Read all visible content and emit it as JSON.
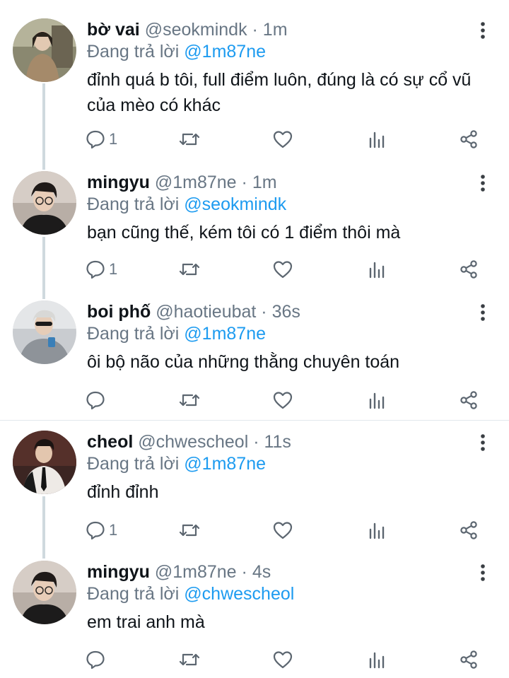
{
  "colors": {
    "text": "#0f1419",
    "secondary": "#687684",
    "link": "#1d9bf0",
    "thread": "#cfd9de"
  },
  "replies": [
    {
      "name": "bờ vai",
      "handle": "@seokmindk",
      "time": "1m",
      "replying_label": "Đang trả lời",
      "replying_to": "@1m87ne",
      "text": "đỉnh quá b tôi, full điểm luôn, đúng là có sự cổ vũ của mèo có khác",
      "reply_count": "1",
      "avatar": "avatar-photo-boy-with-long-hair"
    },
    {
      "name": "mingyu",
      "handle": "@1m87ne",
      "time": "1m",
      "replying_label": "Đang trả lời",
      "replying_to": "@seokmindk",
      "text": "bạn cũng thế, kém tôi có 1 điểm thôi mà",
      "reply_count": "1",
      "avatar": "avatar-photo-boy-with-glasses"
    },
    {
      "name": "boi phố",
      "handle": "@haotieubat",
      "time": "36s",
      "replying_label": "Đang trả lời",
      "replying_to": "@1m87ne",
      "text": "ôi bộ não của những thằng chuyên toán",
      "reply_count": "",
      "avatar": "avatar-photo-boy-with-sunglasses"
    },
    {
      "name": "cheol",
      "handle": "@chwescheol",
      "time": "11s",
      "replying_label": "Đang trả lời",
      "replying_to": "@1m87ne",
      "text": "đỉnh đỉnh",
      "reply_count": "1",
      "avatar": "avatar-photo-man-in-suit"
    },
    {
      "name": "mingyu",
      "handle": "@1m87ne",
      "time": "4s",
      "replying_label": "Đang trả lời",
      "replying_to": "@chwescheol",
      "text": "em trai anh mà",
      "reply_count": "",
      "avatar": "avatar-photo-boy-with-glasses"
    }
  ],
  "separator": " · "
}
